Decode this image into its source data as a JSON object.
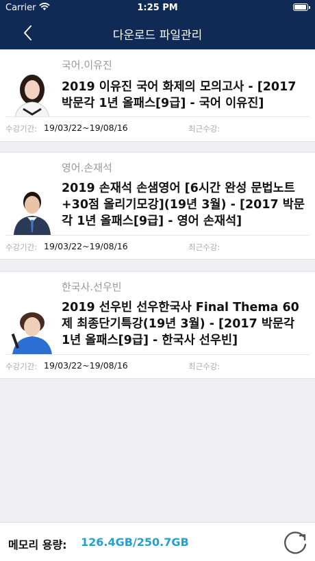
{
  "status_bar": {
    "carrier": "Carrier",
    "time": "1:25 PM",
    "battery_level": 0.85
  },
  "nav": {
    "title": "다운로드 파일관리",
    "back_icon": "chevron-left-icon"
  },
  "items": [
    {
      "teacher": "국어.이유진",
      "course": "2019 이유진 국어 화제의 모의고사 - [2017 박문각 1년 올패스[9급] - 국어 이유진]",
      "period_label": "수강기간:",
      "period_value": "19/03/22~19/08/16",
      "recent_label": "최근수강:",
      "recent_value": ""
    },
    {
      "teacher": "영어.손재석",
      "course": "2019 손재석 손샘영어 [6시간 완성 문법노트+30점 올리기모강](19년 3월) - [2017 박문각 1년 올패스[9급] - 영어 손재석]",
      "period_label": "수강기간:",
      "period_value": "19/03/22~19/08/16",
      "recent_label": "최근수강:",
      "recent_value": ""
    },
    {
      "teacher": "한국사.선우빈",
      "course": "2019 선우빈 선우한국사 Final Thema 60제 최종단기특강(19년 3월) - [2017 박문각 1년 올패스[9급] - 한국사 선우빈]",
      "period_label": "수강기간:",
      "period_value": "19/03/22~19/08/16",
      "recent_label": "최근수강:",
      "recent_value": ""
    }
  ],
  "footer": {
    "memory_label": "메모리 용량:",
    "memory_value": "126.4GB/250.7GB",
    "refresh_icon": "refresh-icon"
  }
}
